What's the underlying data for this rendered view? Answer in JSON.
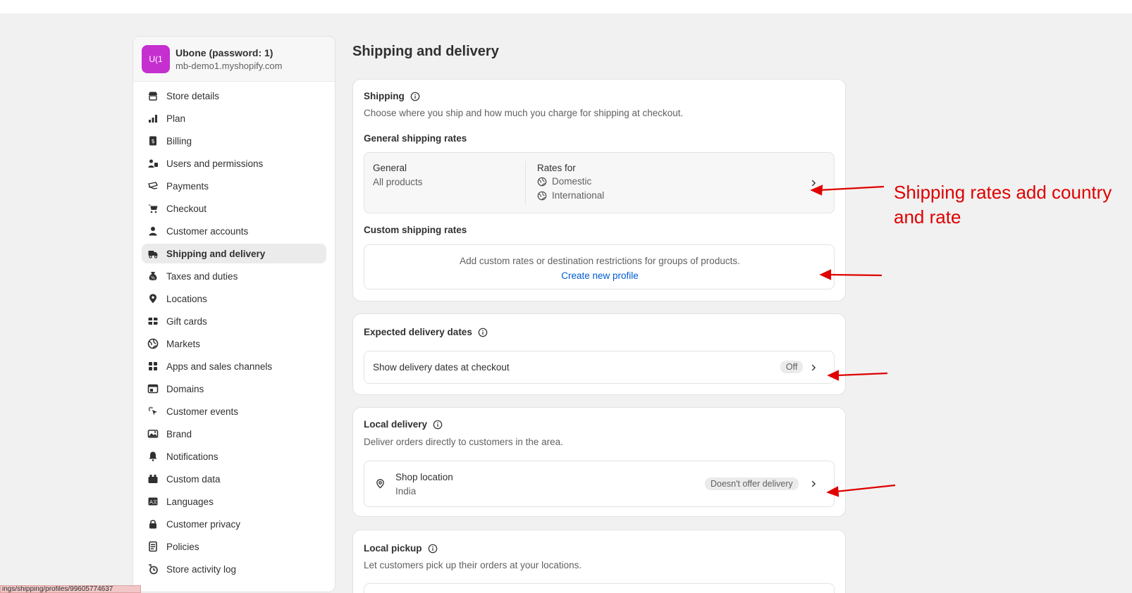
{
  "store": {
    "avatar_initials": "U(1",
    "name": "Ubone (password: 1)",
    "domain": "mb-demo1.myshopify.com"
  },
  "sidebar": {
    "items": [
      {
        "label": "Store details",
        "icon": "store-icon"
      },
      {
        "label": "Plan",
        "icon": "plan-icon"
      },
      {
        "label": "Billing",
        "icon": "billing-icon"
      },
      {
        "label": "Users and permissions",
        "icon": "users-icon"
      },
      {
        "label": "Payments",
        "icon": "payments-icon"
      },
      {
        "label": "Checkout",
        "icon": "cart-icon"
      },
      {
        "label": "Customer accounts",
        "icon": "person-icon"
      },
      {
        "label": "Shipping and delivery",
        "icon": "truck-icon",
        "active": true
      },
      {
        "label": "Taxes and duties",
        "icon": "tax-icon"
      },
      {
        "label": "Locations",
        "icon": "location-pin-icon"
      },
      {
        "label": "Gift cards",
        "icon": "gift-card-icon"
      },
      {
        "label": "Markets",
        "icon": "globe-icon"
      },
      {
        "label": "Apps and sales channels",
        "icon": "apps-icon"
      },
      {
        "label": "Domains",
        "icon": "domains-icon"
      },
      {
        "label": "Customer events",
        "icon": "cursor-click-icon"
      },
      {
        "label": "Brand",
        "icon": "brand-icon"
      },
      {
        "label": "Notifications",
        "icon": "bell-icon"
      },
      {
        "label": "Custom data",
        "icon": "custom-data-icon"
      },
      {
        "label": "Languages",
        "icon": "language-icon"
      },
      {
        "label": "Customer privacy",
        "icon": "lock-icon"
      },
      {
        "label": "Policies",
        "icon": "policies-icon"
      },
      {
        "label": "Store activity log",
        "icon": "activity-log-icon"
      }
    ]
  },
  "main": {
    "title": "Shipping and delivery",
    "shipping": {
      "title": "Shipping",
      "description": "Choose where you ship and how much you charge for shipping at checkout.",
      "general_rates_title": "General shipping rates",
      "general_profile_name": "General",
      "general_profile_scope": "All products",
      "rates_for_label": "Rates for",
      "rate_zones": [
        "Domestic",
        "International"
      ],
      "custom_rates_title": "Custom shipping rates",
      "custom_rates_text": "Add custom rates or destination restrictions for groups of products.",
      "create_profile_link": "Create new profile"
    },
    "expected_delivery": {
      "title": "Expected delivery dates",
      "row_label": "Show delivery dates at checkout",
      "status": "Off"
    },
    "local_delivery": {
      "title": "Local delivery",
      "description": "Deliver orders directly to customers in the area.",
      "location_name": "Shop location",
      "location_country": "India",
      "status": "Doesn't offer delivery"
    },
    "local_pickup": {
      "title": "Local pickup",
      "description": "Let customers pick up their orders at your locations."
    }
  },
  "annotation": {
    "line1": "Shipping rates add country",
    "line2": "and rate",
    "color": "#e00000"
  },
  "status_bar": {
    "url": "ings/shipping/profiles/99605774637"
  },
  "colors": {
    "link": "#005bd3",
    "avatar": "#c52fd0",
    "background": "#f1f1f1"
  }
}
